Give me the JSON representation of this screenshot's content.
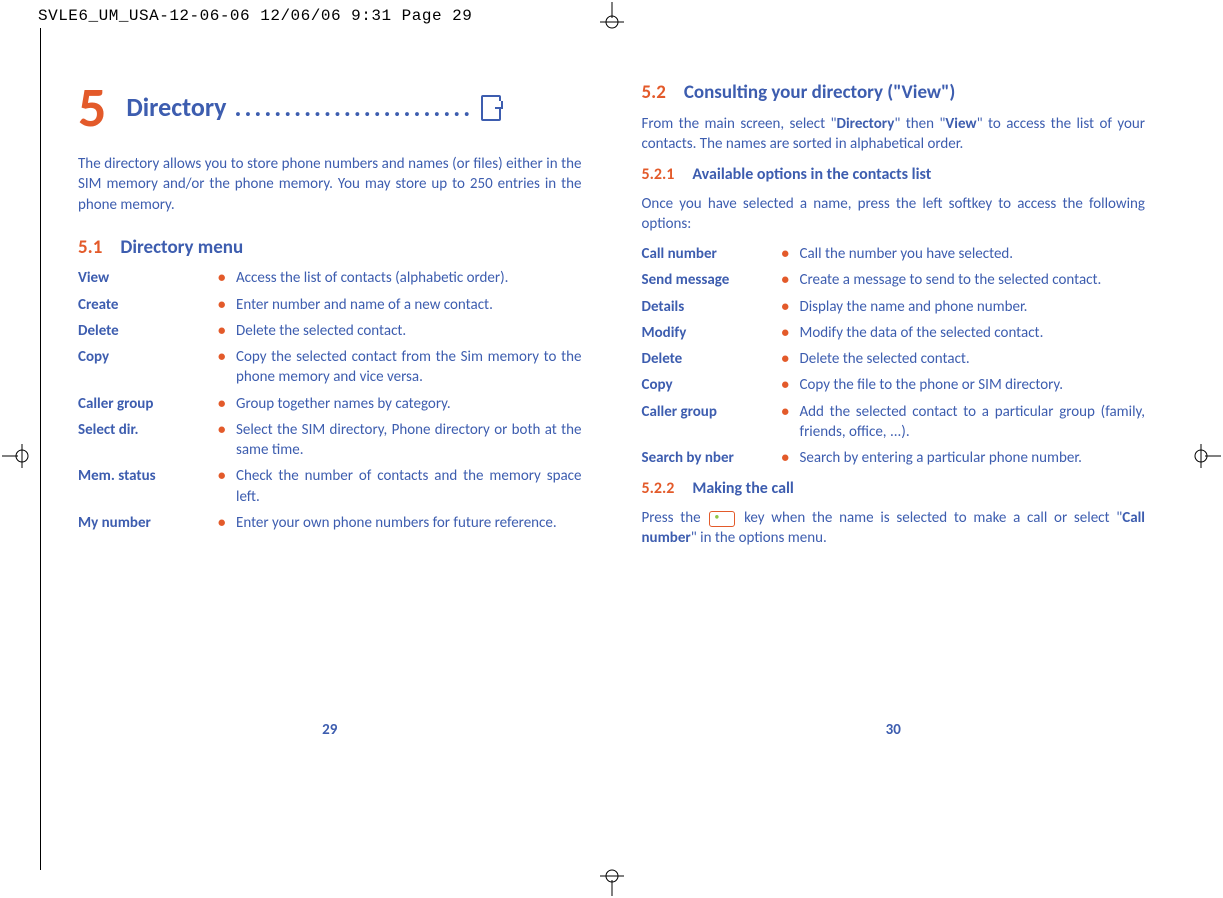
{
  "print_header": "SVLE6_UM_USA-12-06-06  12/06/06  9:31  Page 29",
  "left": {
    "chapter_num": "5",
    "chapter_title": "Directory",
    "chapter_dots": "........................",
    "intro1": "The directory allows you to store phone numbers and names (or files) either in the SIM memory and/or the phone memory. You may store up to 250 entries in the phone memory.",
    "sec1_num": "5.1",
    "sec1_title": "Directory menu",
    "menu": [
      {
        "label": "View",
        "desc": "Access the list of contacts (alphabetic order)."
      },
      {
        "label": "Create",
        "desc": "Enter number and name of a new contact."
      },
      {
        "label": "Delete",
        "desc": "Delete the selected contact."
      },
      {
        "label": "Copy",
        "desc": "Copy the selected contact from the Sim memory to the phone memory and vice versa."
      },
      {
        "label": "Caller group",
        "desc": "Group together names by category."
      },
      {
        "label": "Select dir.",
        "desc": "Select the SIM directory, Phone directory or both at the same time."
      },
      {
        "label": "Mem. status",
        "desc": "Check the number of contacts and the memory space left."
      },
      {
        "label": "My number",
        "desc": "Enter your own phone numbers for future reference."
      }
    ],
    "page_num": "29"
  },
  "right": {
    "sec2_num": "5.2",
    "sec2_title": "Consulting your directory (\"View\")",
    "p1_pre": "From the main screen, select \"",
    "p1_b1": "Directory",
    "p1_mid": "\" then \"",
    "p1_b2": "View",
    "p1_post": "\" to access the list of your contacts. The names are sorted in alphabetical order.",
    "sub1_num": "5.2.1",
    "sub1_title": "Available options in the contacts list",
    "p2": "Once you have selected a name, press the left softkey to access the following options:",
    "menu": [
      {
        "label": "Call number",
        "desc": "Call the number you have selected."
      },
      {
        "label": "Send message",
        "desc": "Create a message to send to the selected contact."
      },
      {
        "label": "Details",
        "desc": "Display the name and phone number."
      },
      {
        "label": "Modify",
        "desc": "Modify the data of the selected contact."
      },
      {
        "label": "Delete",
        "desc": "Delete the selected contact."
      },
      {
        "label": "Copy",
        "desc": "Copy the file to the phone or SIM directory."
      },
      {
        "label": "Caller group",
        "desc": "Add the selected contact to a particular group (family, friends, office, ...)."
      },
      {
        "label": "Search by nber",
        "desc": "Search by entering a particular phone number."
      }
    ],
    "sub2_num": "5.2.2",
    "sub2_title": "Making the call",
    "p3_pre": "Press the ",
    "p3_mid": " key when the name is selected to make a call or select \"",
    "p3_b1": "Call number",
    "p3_post": "\" in the options menu.",
    "page_num": "30"
  }
}
